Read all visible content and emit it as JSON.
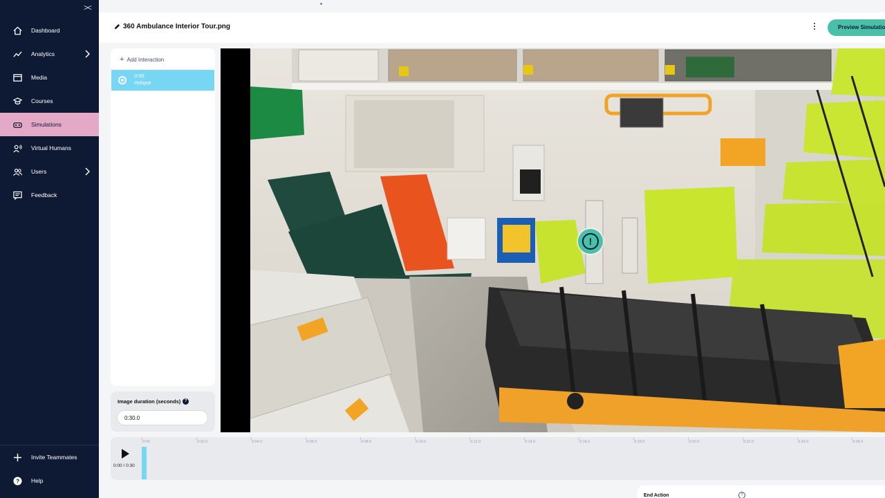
{
  "sidebar": {
    "collapse_icon": "collapse-icon",
    "items": [
      {
        "label": "Dashboard",
        "icon": "home-icon"
      },
      {
        "label": "Analytics",
        "icon": "chart-icon",
        "has_chevron": true
      },
      {
        "label": "Media",
        "icon": "media-icon"
      },
      {
        "label": "Courses",
        "icon": "courses-icon"
      },
      {
        "label": "Simulations",
        "icon": "vr-headset-icon",
        "active": true
      },
      {
        "label": "Virtual Humans",
        "icon": "virtual-human-icon"
      },
      {
        "label": "Users",
        "icon": "users-icon",
        "has_chevron": true
      },
      {
        "label": "Feedback",
        "icon": "feedback-icon"
      }
    ],
    "bottom_items": [
      {
        "label": "Invite Teammates",
        "icon": "plus-icon"
      },
      {
        "label": "Help",
        "icon": "help-icon"
      }
    ]
  },
  "header": {
    "title": "360 Ambulance Interior Tour.png",
    "preview_label": "Preview Simulation"
  },
  "interactions": {
    "add_label": "Add Interaction",
    "items": [
      {
        "time": "0:00",
        "type": "Hotspot"
      }
    ]
  },
  "duration": {
    "label": "Image duration (seconds)",
    "value": "0:30.0"
  },
  "viewer": {
    "hotspot_glyph": "!"
  },
  "timeline": {
    "time_readout": "0:00 / 0:30",
    "ticks": [
      "0:00",
      "0:02.0",
      "0:04.0",
      "0:06.0",
      "0:08.0",
      "0:10.0",
      "0:12.0",
      "0:14.0",
      "0:16.0",
      "0:18.0",
      "0:20.0",
      "0:22.0",
      "0:24.0",
      "0:26.0"
    ]
  },
  "end_action": {
    "label": "End Action"
  },
  "colors": {
    "sidebar_bg": "#0e1a33",
    "active_nav": "#e5a9c8",
    "accent_teal": "#49c0aa",
    "selected_blue": "#78d6f5"
  }
}
